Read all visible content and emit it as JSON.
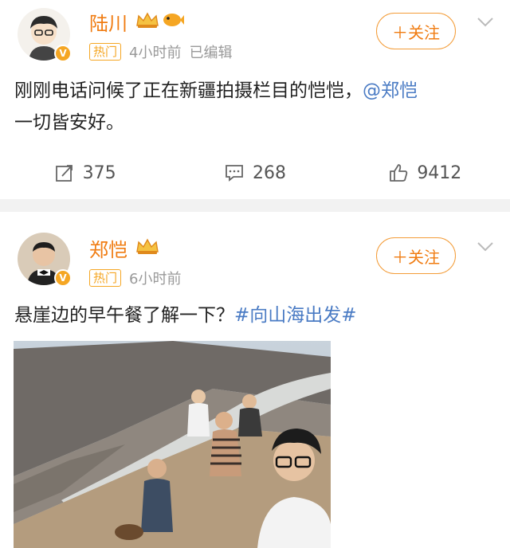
{
  "posts": [
    {
      "username": "陆川",
      "hot_label": "热门",
      "time": "4小时前",
      "edited": "已编辑",
      "follow_label": "＋关注",
      "text_main": "刚刚电话问候了正在新疆拍摄栏目的恺恺，",
      "mention": "@郑恺",
      "text_tail": "一切皆安好。",
      "repost_count": "375",
      "comment_count": "268",
      "like_count": "9412",
      "vip_icon": "crown-icon",
      "extra_icon": "fish-icon"
    },
    {
      "username": "郑恺",
      "hot_label": "热门",
      "time": "6小时前",
      "follow_label": "＋关注",
      "text_main": "悬崖边的早午餐了解一下？",
      "topic": "#向山海出发#",
      "vip_icon": "crown-icon"
    }
  ],
  "colors": {
    "accent": "#f07c12",
    "link": "#4a7bc4",
    "badge": "#f5a623"
  }
}
